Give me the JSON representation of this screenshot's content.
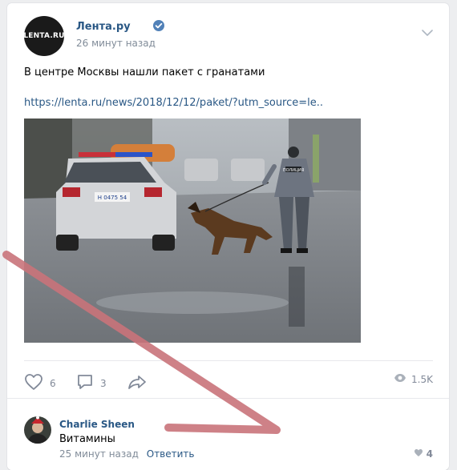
{
  "post": {
    "author": "Лента.ру",
    "avatar_text": "LENTA.RU",
    "time": "26 минут назад",
    "text": "В центре Москвы нашли пакет с гранатами",
    "link": "https://lenta.ru/news/2018/12/12/paket/?utm_source=le..",
    "photo": {
      "car_plate": "Н 0475 54",
      "vest_text": "ПОЛИЦИЯ"
    },
    "likes": "6",
    "comments": "3",
    "views": "1.5K"
  },
  "comment": {
    "author": "Charlie Sheen",
    "text": "Витамины",
    "time": "25 минут назад",
    "reply_label": "Ответить",
    "likes": "4"
  },
  "colors": {
    "link": "#2a5885",
    "muted": "#818c99",
    "overlay_stroke": "#c9737a"
  },
  "icons": [
    "verified-icon",
    "chevron-down-icon",
    "heart-icon",
    "comment-icon",
    "share-icon",
    "eye-icon"
  ]
}
